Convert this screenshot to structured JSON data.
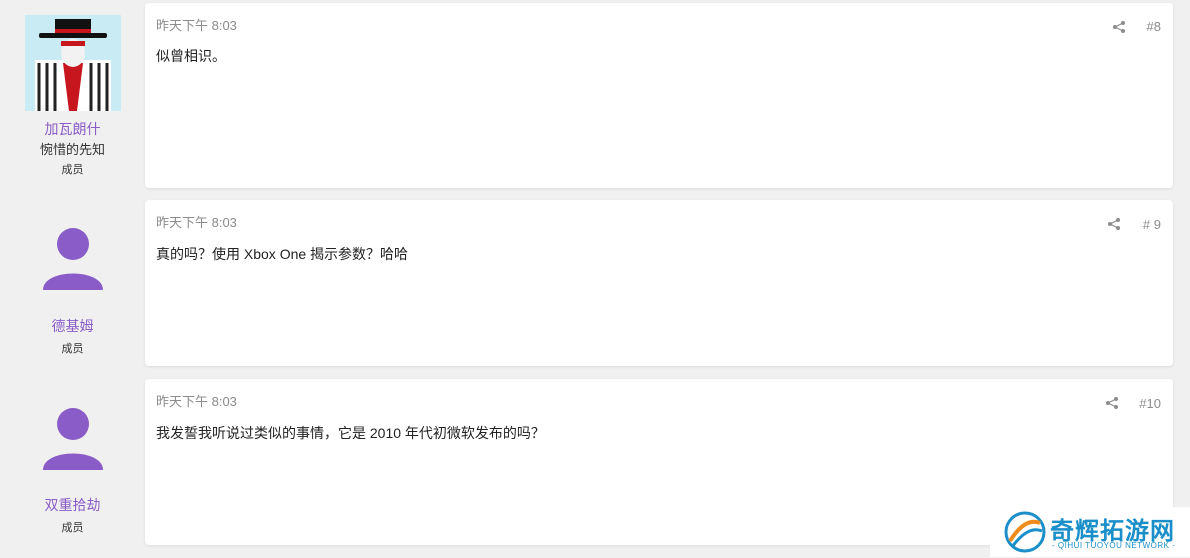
{
  "posts": [
    {
      "user": {
        "name": "加瓦朗什",
        "title": "惋惜的先知",
        "role": "成员",
        "avatar": "photo-avatar"
      },
      "time": "昨天下午 8:03",
      "number": "#8",
      "content": "似曾相识。"
    },
    {
      "user": {
        "name": "德基姆",
        "role": "成员",
        "avatar": "default-user-avatar"
      },
      "time": "昨天下午 8:03",
      "number": "# 9",
      "content": "真的吗？使用 Xbox One 揭示参数？哈哈"
    },
    {
      "user": {
        "name": "双重拾劫",
        "role": "成员",
        "avatar": "default-user-avatar"
      },
      "time": "昨天下午 8:03",
      "number": "#10",
      "content": "我发誓我听说过类似的事情，它是 2010 年代初微软发布的吗？"
    }
  ],
  "watermark": {
    "title": "奇辉拓游网",
    "subtitle": "- QIHUI TUOYOU NETWORK -"
  },
  "colors": {
    "username": "#8a5cc7",
    "avatar_purple": "#8a5cc7",
    "muted": "#8c8c8c",
    "background": "#f0f0f0",
    "watermark": "#1a8fc9"
  }
}
